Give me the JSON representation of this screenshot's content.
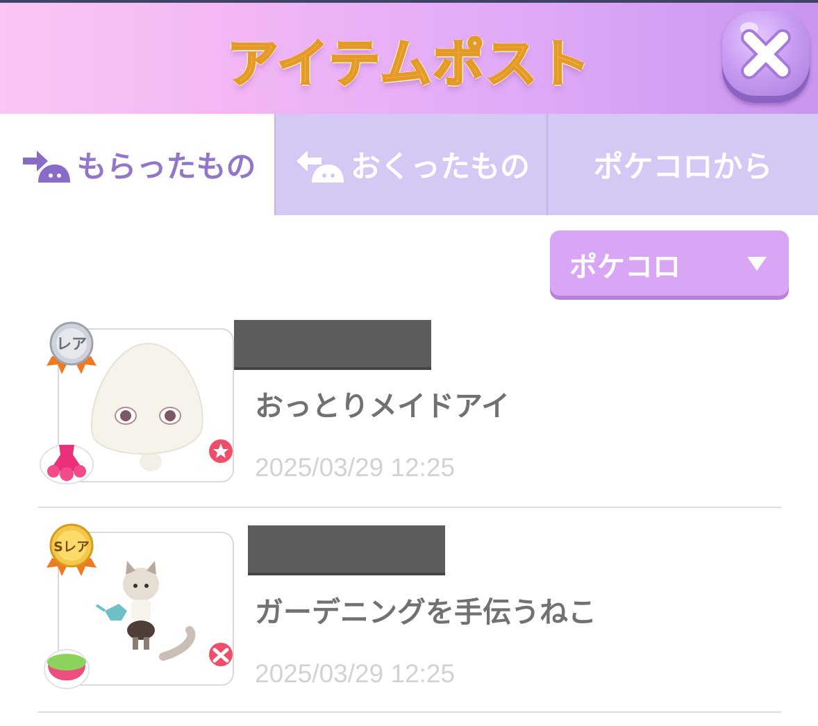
{
  "header": {
    "title": "アイテムポスト",
    "close_icon": "close-icon"
  },
  "tabs": [
    {
      "label": "もらったもの",
      "icon": "receive-arrow-icon",
      "active": true
    },
    {
      "label": "おくったもの",
      "icon": "send-arrow-icon",
      "active": false
    },
    {
      "label": "ポケコロから",
      "active": false
    }
  ],
  "filter": {
    "selected": "ポケコロ",
    "icon": "dropdown-triangle-icon"
  },
  "items": [
    {
      "rarity_label": "レア",
      "rarity_color": "#b9bcc6",
      "name": "おっとりメイドアイ",
      "date": "2025/03/29 12:25",
      "category_icon": "dress-icon",
      "badge_icon": "star-badge-icon"
    },
    {
      "rarity_label": "Sレア",
      "rarity_color": "#f3c23c",
      "name": "ガーデニングを手伝うねこ",
      "date": "2025/03/29 12:25",
      "category_icon": "pet-food-icon",
      "badge_icon": "pet-badge-icon"
    }
  ],
  "colors": {
    "header_gradient_start": "#fbc6f3",
    "header_gradient_end": "#c995f0",
    "tab_active_text": "#9276c9",
    "tab_inactive_bg": "#d6c8f4",
    "filter_bg": "#d8a6f5",
    "title": "#f6b93d"
  }
}
